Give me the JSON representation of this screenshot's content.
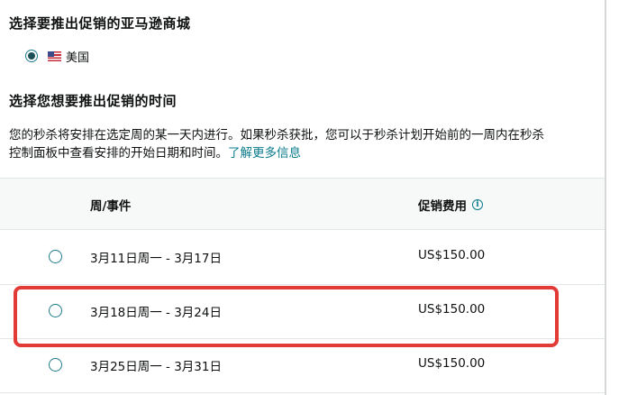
{
  "marketplace": {
    "heading": "选择要推出促销的亚马逊商城",
    "selected_option": {
      "flag_icon": "us-flag-icon",
      "label": "美国"
    }
  },
  "timing": {
    "heading": "选择您想要推出促销的时间",
    "description_line1": "您的秒杀将安排在选定周的某一天内进行。如果秒杀获批，您可以于秒杀计划开始前的一周内在秒杀",
    "description_line2": "控制面板中查看安排的开始日期和时间。",
    "learn_more": "了解更多信息"
  },
  "table": {
    "col_week": "周/事件",
    "col_fee": "促销费用",
    "info_icon": "info-icon",
    "rows": [
      {
        "week": "3月11日周一 - 3月17日",
        "fee": "US$150.00"
      },
      {
        "week": "3月18日周一 - 3月24日",
        "fee": "US$150.00"
      },
      {
        "week": "3月25日周一 - 3月31日",
        "fee": "US$150.00"
      }
    ]
  },
  "colors": {
    "accent": "#0a7b8c",
    "highlight": "#e23a35",
    "header_bg": "#f7f8f8"
  }
}
